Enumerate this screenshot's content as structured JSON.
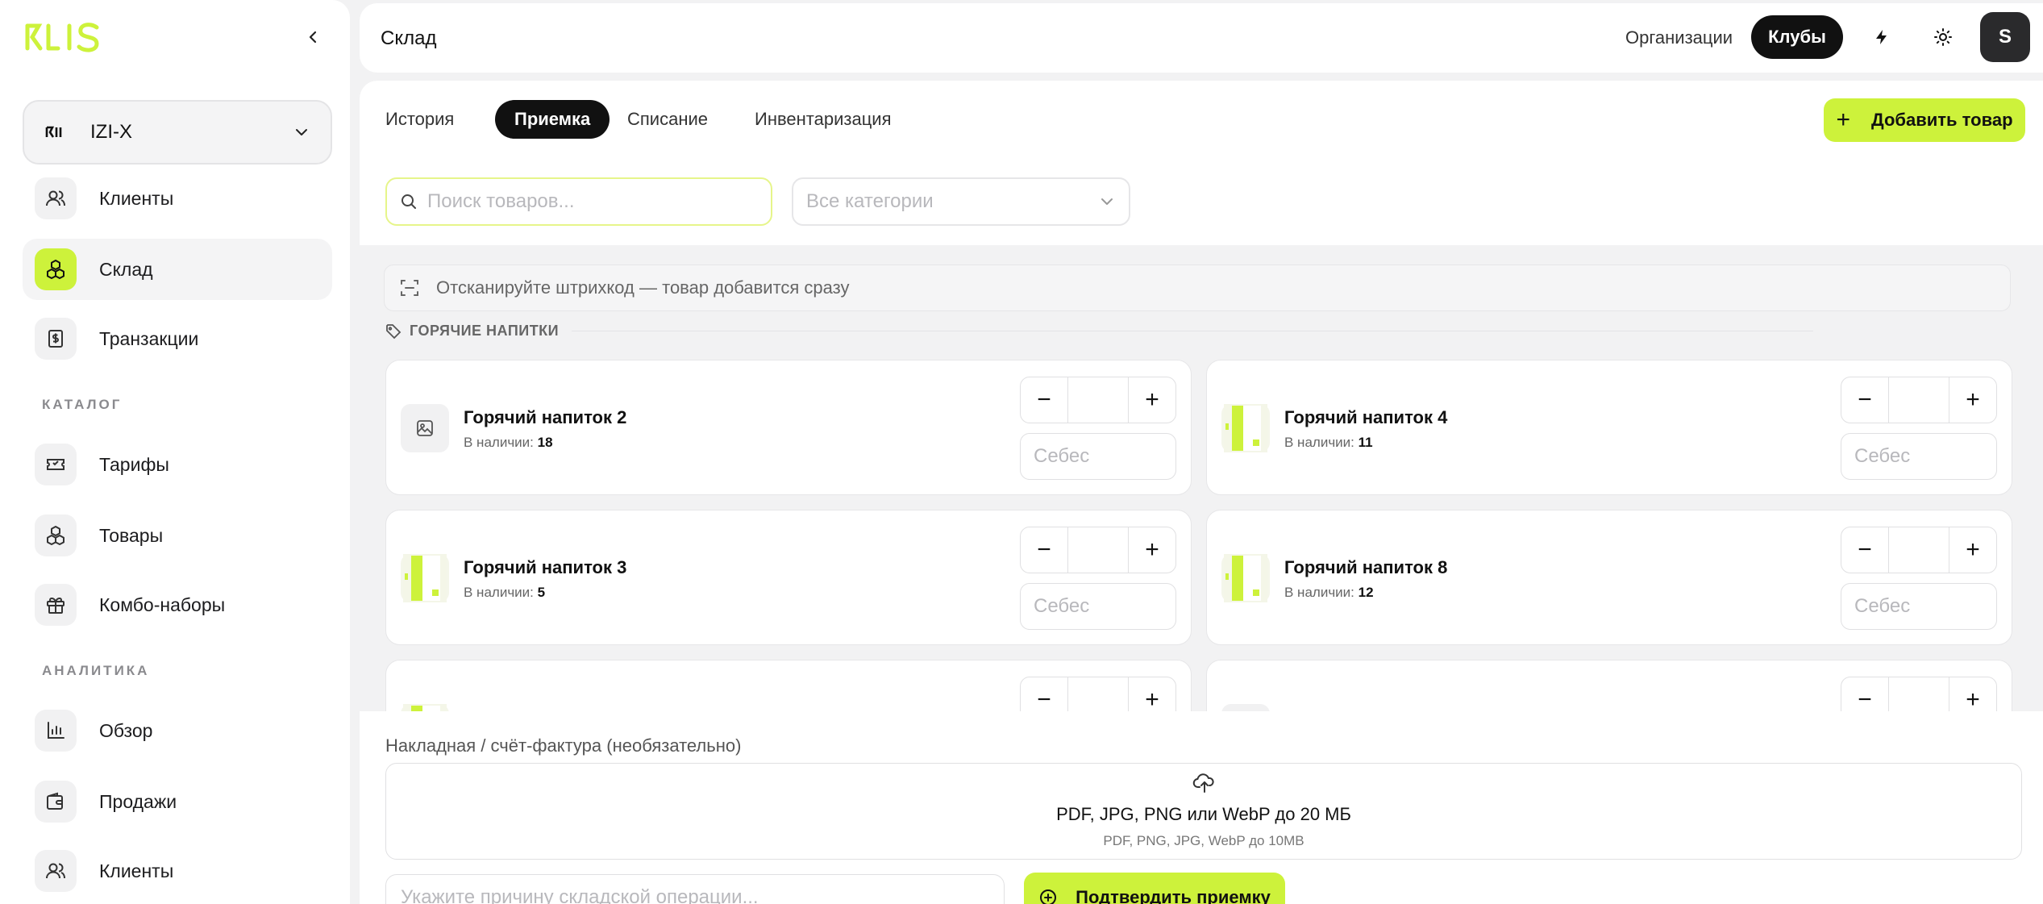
{
  "sidebar": {
    "org_name": "IZI-X",
    "items": [
      {
        "label": "Клиенты",
        "icon": "users-icon"
      },
      {
        "label": "Склад",
        "icon": "boxes-icon"
      },
      {
        "label": "Транзакции",
        "icon": "receipt-icon"
      }
    ],
    "catalog_label": "КАТАЛОГ",
    "catalog_items": [
      {
        "label": "Тарифы",
        "icon": "ticket-icon"
      },
      {
        "label": "Товары",
        "icon": "boxes-icon"
      },
      {
        "label": "Комбо-наборы",
        "icon": "gift-icon"
      }
    ],
    "analytics_label": "АНАЛИТИКА",
    "analytics_items": [
      {
        "label": "Обзор",
        "icon": "bar-chart-icon"
      },
      {
        "label": "Продажи",
        "icon": "wallet-icon"
      },
      {
        "label": "Клиенты",
        "icon": "users-icon"
      }
    ]
  },
  "header": {
    "title": "Склад",
    "organizations": "Организации",
    "clubs": "Клубы",
    "avatar_letter": "S"
  },
  "tabs": [
    "История",
    "Приемка",
    "Списание",
    "Инвентаризация"
  ],
  "add_button": "Добавить товар",
  "search": {
    "placeholder": "Поиск товаров..."
  },
  "category_select": "Все категории",
  "scan_hint": "Отсканируйте штрихкод — товар добавится сразу",
  "group_title": "ГОРЯЧИЕ НАПИТКИ",
  "stock_label": "В наличии:",
  "cost_placeholder": "Себес",
  "products": [
    {
      "name": "Горячий напиток 2",
      "stock": "18",
      "thumb": "image-icon"
    },
    {
      "name": "Горячий напиток 4",
      "stock": "11",
      "thumb": "product-thumb"
    },
    {
      "name": "Горячий напиток 3",
      "stock": "5",
      "thumb": "product-thumb"
    },
    {
      "name": "Горячий напиток 8",
      "stock": "12",
      "thumb": "product-thumb"
    }
  ],
  "bottom": {
    "invoice_label": "Накладная / счёт-фактура (необязательно)",
    "upload_title": "PDF, JPG, PNG или WebP до 20 МБ",
    "upload_sub": "PDF, PNG, JPG, WebP до 10MB",
    "reason_placeholder": "Укажите причину складской операции...",
    "confirm": "Подтвердить приемку"
  },
  "colors": {
    "accent": "#cdf23b",
    "arrow": "#e8473a"
  }
}
